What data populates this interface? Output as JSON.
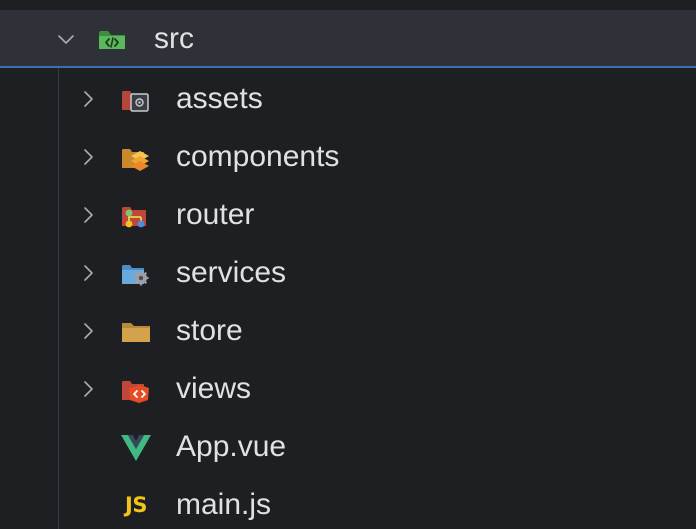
{
  "tree": {
    "root": {
      "label": "src",
      "expanded": true
    },
    "children": [
      {
        "label": "assets",
        "type": "folder",
        "icon": "assets-folder-icon"
      },
      {
        "label": "components",
        "type": "folder",
        "icon": "components-folder-icon"
      },
      {
        "label": "router",
        "type": "folder",
        "icon": "router-folder-icon"
      },
      {
        "label": "services",
        "type": "folder",
        "icon": "services-folder-icon"
      },
      {
        "label": "store",
        "type": "folder",
        "icon": "folder-icon"
      },
      {
        "label": "views",
        "type": "folder",
        "icon": "views-folder-icon"
      },
      {
        "label": "App.vue",
        "type": "file",
        "icon": "vue-file-icon"
      },
      {
        "label": "main.js",
        "type": "file",
        "icon": "js-file-icon",
        "icon_text": "JS"
      }
    ]
  },
  "colors": {
    "background": "#1e1f22",
    "selected_row": "#2e3138",
    "selection_accent": "#3d6fb4",
    "text": "#dfe1e5",
    "vue_green": "#41b883",
    "js_yellow": "#f0c419"
  }
}
